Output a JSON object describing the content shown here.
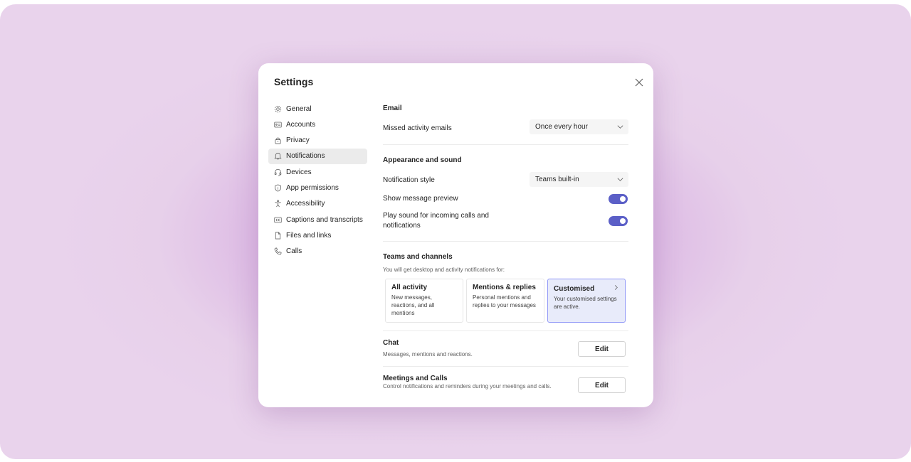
{
  "dialog": {
    "title": "Settings"
  },
  "sidebar": {
    "items": [
      {
        "label": "General",
        "icon": "gear-icon"
      },
      {
        "label": "Accounts",
        "icon": "id-card-icon"
      },
      {
        "label": "Privacy",
        "icon": "lock-icon"
      },
      {
        "label": "Notifications",
        "icon": "bell-icon",
        "active": true
      },
      {
        "label": "Devices",
        "icon": "headset-icon"
      },
      {
        "label": "App permissions",
        "icon": "shield-icon"
      },
      {
        "label": "Accessibility",
        "icon": "accessibility-icon"
      },
      {
        "label": "Captions and transcripts",
        "icon": "closed-captions-icon"
      },
      {
        "label": "Files and links",
        "icon": "document-icon"
      },
      {
        "label": "Calls",
        "icon": "phone-icon"
      }
    ]
  },
  "email": {
    "title": "Email",
    "missed_label": "Missed activity emails",
    "missed_value": "Once every hour"
  },
  "appearance": {
    "title": "Appearance and sound",
    "style_label": "Notification style",
    "style_value": "Teams built-in",
    "preview_label": "Show message preview",
    "preview_on": true,
    "sound_label": "Play sound for incoming calls and notifications",
    "sound_on": true
  },
  "teams": {
    "title": "Teams and channels",
    "subtitle": "You will get desktop and activity notifications for:",
    "cards": [
      {
        "title": "All activity",
        "desc": "New messages, reactions, and all mentions",
        "selected": false
      },
      {
        "title": "Mentions & replies",
        "desc": "Personal mentions and replies to your messages",
        "selected": false
      },
      {
        "title": "Customised",
        "desc": "Your customised settings are active.",
        "selected": true
      }
    ]
  },
  "chat": {
    "title": "Chat",
    "desc": "Messages, mentions and reactions.",
    "edit_label": "Edit"
  },
  "meetings": {
    "title": "Meetings and Calls",
    "desc": "Control notifications and reminders during your meetings and calls.",
    "edit_label": "Edit"
  },
  "colors": {
    "accent": "#5b5fc7",
    "selected_card_bg": "#e8ebfa",
    "backdrop": "#e7d0ea"
  }
}
